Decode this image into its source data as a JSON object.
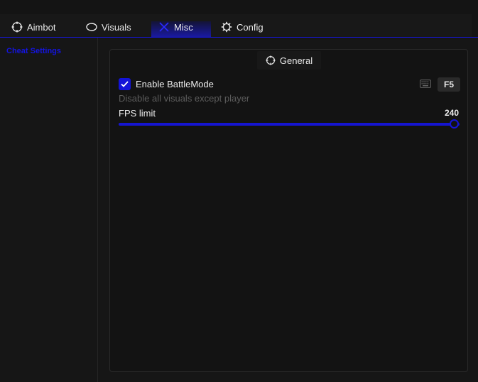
{
  "tabs": [
    {
      "label": "Aimbot",
      "icon": "crosshair-icon"
    },
    {
      "label": "Visuals",
      "icon": "eye-icon"
    },
    {
      "label": "Misc",
      "icon": "tools-icon"
    },
    {
      "label": "Config",
      "icon": "gear-icon"
    }
  ],
  "active_tab": "Misc",
  "sidebar": {
    "items": [
      {
        "label": "Cheat Settings"
      }
    ]
  },
  "panel": {
    "title": "General",
    "title_icon": "crosshair-icon",
    "option": {
      "label": "Enable BattleMode",
      "checked": true,
      "description": "Disable all visuals except player",
      "hotkey": "F5",
      "hotkey_icon": "keyboard-icon"
    },
    "slider": {
      "label": "FPS limit",
      "value": "240",
      "fraction": 1.0
    }
  },
  "colors": {
    "accent": "#1515d0",
    "background": "#161616",
    "panel": "#131313",
    "text": "#e9e9e9",
    "muted_text": "#5c5c5c"
  }
}
